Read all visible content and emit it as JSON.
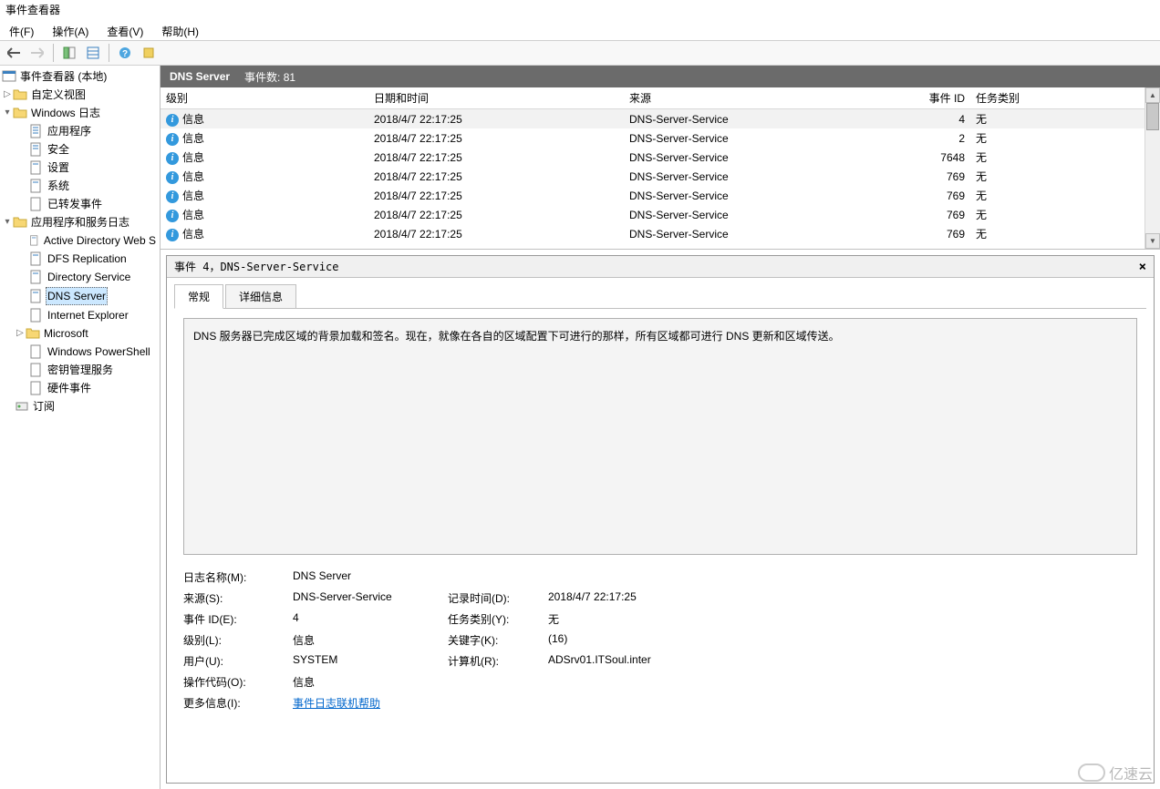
{
  "window": {
    "title": "事件查看器"
  },
  "menu": {
    "file": "件(F)",
    "action": "操作(A)",
    "view": "查看(V)",
    "help": "帮助(H)"
  },
  "tree": {
    "root": "事件查看器 (本地)",
    "custom_views": "自定义视图",
    "windows_logs": "Windows 日志",
    "app": "应用程序",
    "security": "安全",
    "setup": "设置",
    "system": "系统",
    "forwarded": "已转发事件",
    "app_svc_logs": "应用程序和服务日志",
    "adws": "Active Directory Web S",
    "dfs": "DFS Replication",
    "dirsvc": "Directory Service",
    "dns": "DNS Server",
    "ie": "Internet Explorer",
    "ms": "Microsoft",
    "ps": "Windows PowerShell",
    "key": "密钥管理服务",
    "hw": "硬件事件",
    "sub": "订阅"
  },
  "list": {
    "title": "DNS Server",
    "count_label": "事件数: 81",
    "cols": {
      "level": "级别",
      "date": "日期和时间",
      "source": "来源",
      "id": "事件 ID",
      "task": "任务类别"
    },
    "rows": [
      {
        "level": "信息",
        "date": "2018/4/7 22:17:25",
        "source": "DNS-Server-Service",
        "id": "4",
        "task": "无"
      },
      {
        "level": "信息",
        "date": "2018/4/7 22:17:25",
        "source": "DNS-Server-Service",
        "id": "2",
        "task": "无"
      },
      {
        "level": "信息",
        "date": "2018/4/7 22:17:25",
        "source": "DNS-Server-Service",
        "id": "7648",
        "task": "无"
      },
      {
        "level": "信息",
        "date": "2018/4/7 22:17:25",
        "source": "DNS-Server-Service",
        "id": "769",
        "task": "无"
      },
      {
        "level": "信息",
        "date": "2018/4/7 22:17:25",
        "source": "DNS-Server-Service",
        "id": "769",
        "task": "无"
      },
      {
        "level": "信息",
        "date": "2018/4/7 22:17:25",
        "source": "DNS-Server-Service",
        "id": "769",
        "task": "无"
      },
      {
        "level": "信息",
        "date": "2018/4/7 22:17:25",
        "source": "DNS-Server-Service",
        "id": "769",
        "task": "无"
      }
    ]
  },
  "detail": {
    "header": "事件 4，DNS-Server-Service",
    "tab_general": "常规",
    "tab_details": "详细信息",
    "description": "DNS 服务器已完成区域的背景加载和签名。现在，就像在各自的区域配置下可进行的那样，所有区域都可进行 DNS 更新和区域传送。",
    "labels": {
      "log_name": "日志名称(M):",
      "source": "来源(S):",
      "event_id": "事件 ID(E):",
      "level": "级别(L):",
      "user": "用户(U):",
      "opcode": "操作代码(O):",
      "more": "更多信息(I):",
      "logged": "记录时间(D):",
      "task": "任务类别(Y):",
      "keywords": "关键字(K):",
      "computer": "计算机(R):"
    },
    "values": {
      "log_name": "DNS Server",
      "source": "DNS-Server-Service",
      "event_id": "4",
      "level": "信息",
      "user": "SYSTEM",
      "opcode": "信息",
      "more": "事件日志联机帮助",
      "logged": "2018/4/7 22:17:25",
      "task": "无",
      "keywords": "(16)",
      "computer": "ADSrv01.ITSoul.inter"
    }
  },
  "watermark": "亿速云"
}
